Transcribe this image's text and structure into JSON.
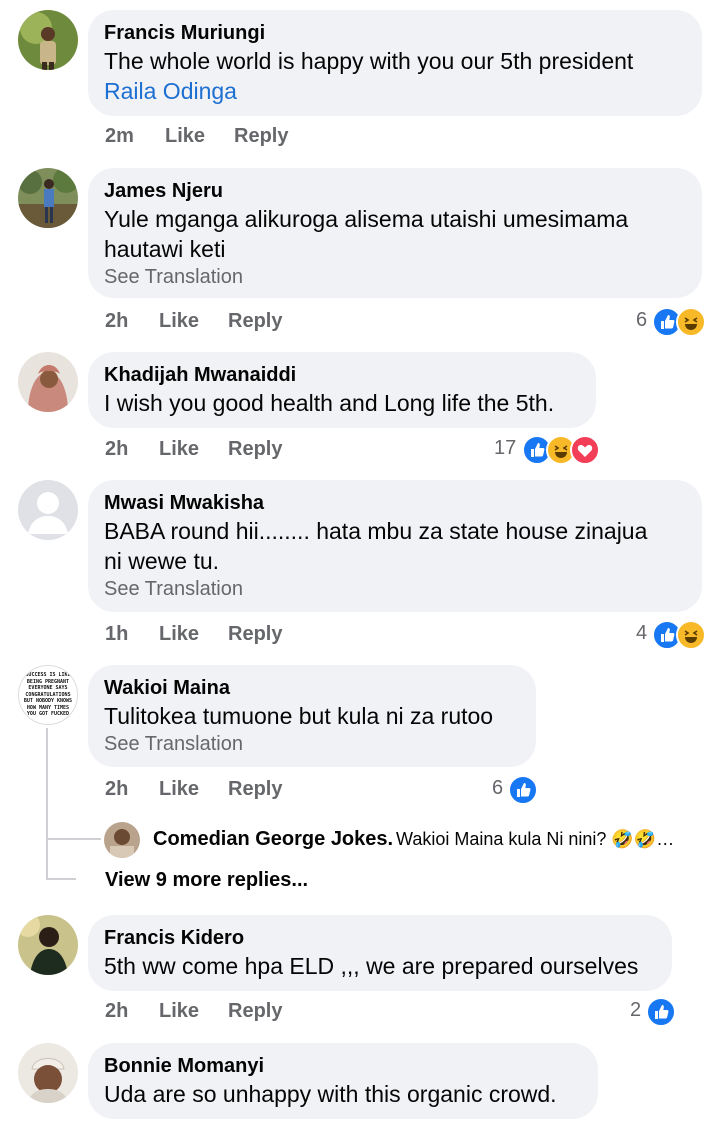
{
  "comments": [
    {
      "author": "Francis Muriungi",
      "text": "The whole world is happy with you our 5th president",
      "mention": "Raila Odinga",
      "time": "2m",
      "like": "Like",
      "reply": "Reply"
    },
    {
      "author": "James Njeru",
      "text1": "Yule mganga alikuroga alisema utaishi umesimama",
      "text2": "hautawi keti",
      "see_translation": "See Translation",
      "time": "2h",
      "like": "Like",
      "reply": "Reply",
      "reactions": "6"
    },
    {
      "author": "Khadijah Mwanaiddi",
      "text": "I wish you good health and Long life the 5th.",
      "time": "2h",
      "like": "Like",
      "reply": "Reply",
      "reactions": "17"
    },
    {
      "author": "Mwasi Mwakisha",
      "text1": "BABA round hii........ hata mbu za state house zinajua",
      "text2": "ni wewe tu.",
      "see_translation": "See Translation",
      "time": "1h",
      "like": "Like",
      "reply": "Reply",
      "reactions": "4"
    },
    {
      "author": "Wakioi Maina",
      "avatar_text": "SUCCESS IS LIKE BEING PREGNANT EVERYONE SAYS CONGRATULATIONS BUT NOBODY KNOWS HOW MANY TIMES YOU GOT FUCKED",
      "text": "Tulitokea tumuone but kula ni za rutoo",
      "see_translation": "See Translation",
      "time": "2h",
      "like": "Like",
      "reply": "Reply",
      "reactions": "6",
      "reply_preview": {
        "author": "Comedian George Jokes.",
        "text": "Wakioi Maina kula Ni nini? 🤣🤣…"
      },
      "more_replies": "View 9 more replies..."
    },
    {
      "author": "Francis Kidero",
      "text": "5th ww come hpa ELD ,,, we are prepared ourselves",
      "time": "2h",
      "like": "Like",
      "reply": "Reply",
      "reactions": "2"
    },
    {
      "author": "Bonnie Momanyi",
      "text": "Uda are so unhappy with this organic crowd."
    }
  ],
  "colors": {
    "bubble": "#f0f2f5",
    "meta": "#65676b",
    "link": "#1d6fd1",
    "like": "#1877f2",
    "haha": "#f7b928",
    "love": "#f33e58"
  }
}
